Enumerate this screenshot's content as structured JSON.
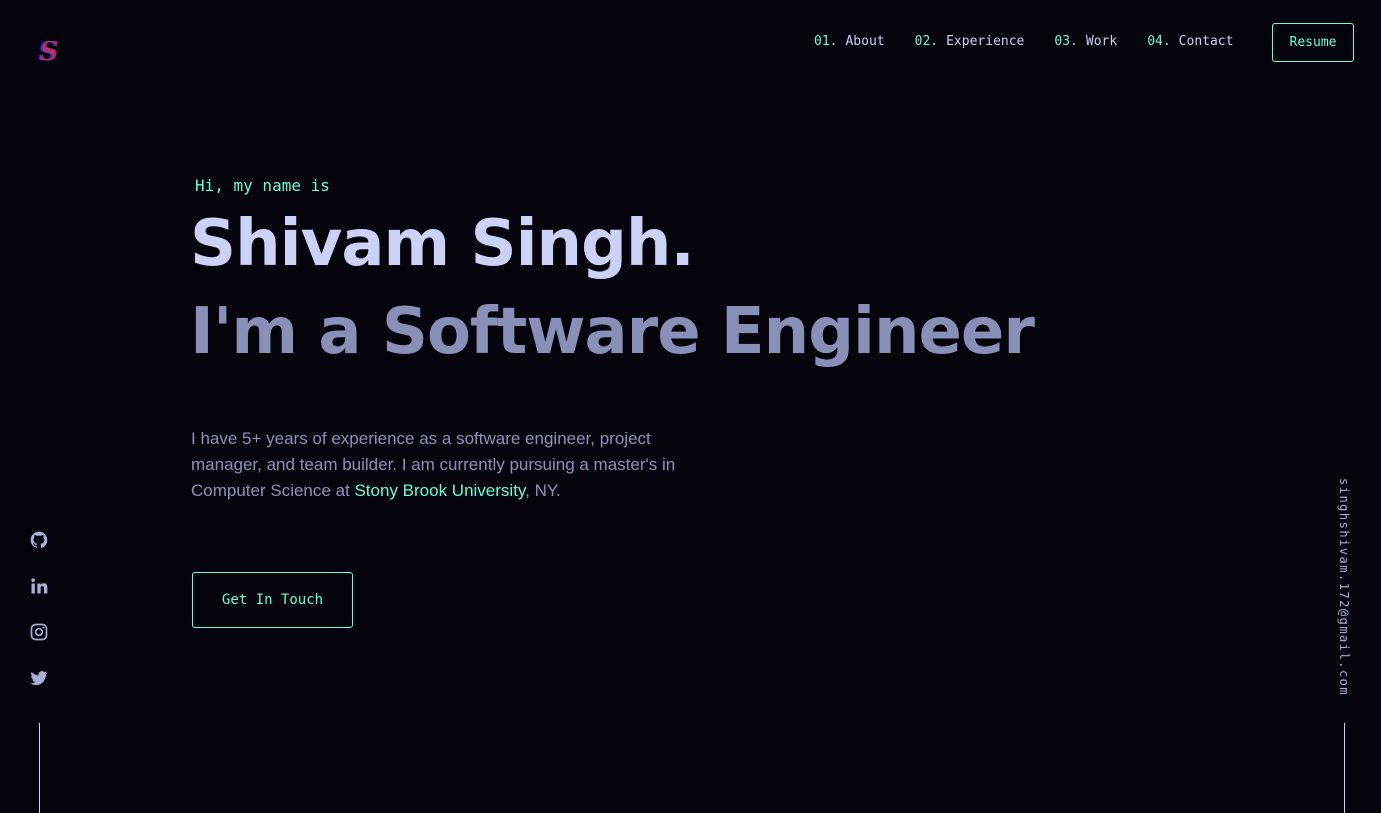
{
  "brand": {
    "logo_icon": "s-monogram-logo-icon",
    "colors": {
      "accent": "#64ffda",
      "logo_primary": "#2a2cc7",
      "logo_secondary": "#e0355a"
    }
  },
  "nav": {
    "items": [
      {
        "num": "01.",
        "label": "About"
      },
      {
        "num": "02.",
        "label": "Experience"
      },
      {
        "num": "03.",
        "label": "Work"
      },
      {
        "num": "04.",
        "label": "Contact"
      }
    ],
    "resume_label": "Resume"
  },
  "hero": {
    "intro": "Hi, my name is",
    "name": "Shivam Singh.",
    "role": "I'm a Software Engineer",
    "desc_prefix": "I have 5+ years of experience as a software engineer, project manager, and team builder. I am currently pursuing a master's in Computer Science at ",
    "desc_link": "Stony Brook University",
    "desc_suffix": ", NY.",
    "cta_label": "Get In Touch"
  },
  "social": [
    "github-icon",
    "linkedin-icon",
    "instagram-icon",
    "twitter-icon"
  ],
  "email": "singhshivam.172@gmail.com"
}
